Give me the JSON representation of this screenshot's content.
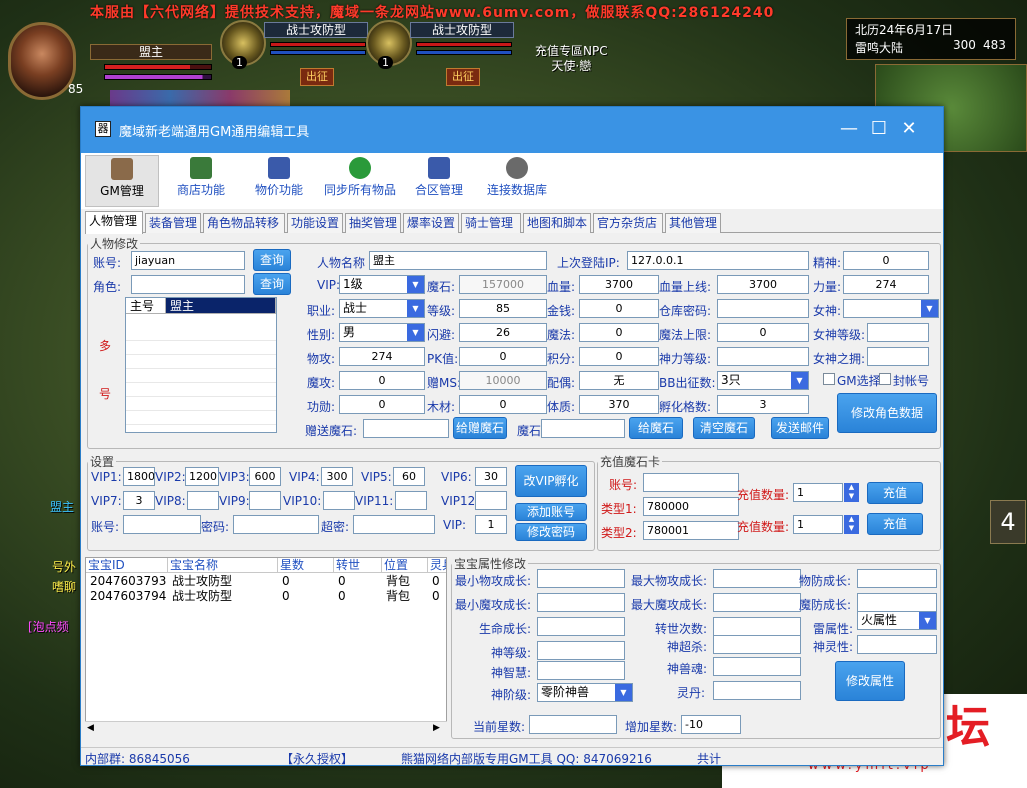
{
  "game": {
    "banner": "本服由【六代网络】提供技术支持，魔域一条龙网站www.6umv.com，做服联系QQ:286124240",
    "player_name": "盟主",
    "player_level": "85",
    "pets": [
      {
        "name": "战士攻防型",
        "level": "1",
        "button": "出征"
      },
      {
        "name": "战士攻防型",
        "level": "1",
        "button": "出征"
      }
    ],
    "npc_text": [
      "充值专區NPC",
      "天使·戀"
    ],
    "date": "北历24年6月17日",
    "map_name": "雷鸣大陆",
    "coord_x": "300",
    "coord_y": "483",
    "chat": [
      "盟主",
      "[泡点频",
      "号外",
      "嗜聊"
    ],
    "side_button": "4"
  },
  "watermark": {
    "title": "隐盟论坛",
    "url": "www.ymlt.vip"
  },
  "window": {
    "title": "魔域新老端通用GM通用编辑工具",
    "icon": "器",
    "controls": [
      "—",
      "☐",
      "✕"
    ]
  },
  "toolbar": [
    {
      "label": "GM管理",
      "icon": "person-icon",
      "color": "#8a6a4a"
    },
    {
      "label": "商店功能",
      "icon": "cart-icon",
      "color": "#3a7a3a"
    },
    {
      "label": "物价功能",
      "icon": "computer-icon",
      "color": "#3a5aaa"
    },
    {
      "label": "同步所有物品",
      "icon": "refresh-icon",
      "color": "#2a9a3a"
    },
    {
      "label": "合区管理",
      "icon": "server-icon",
      "color": "#3a5aaa"
    },
    {
      "label": "连接数据库",
      "icon": "gear-icon",
      "color": "#6a6a6a"
    }
  ],
  "tabs": [
    "人物管理",
    "装备管理",
    "角色物品转移",
    "功能设置",
    "抽奖管理",
    "爆率设置",
    "骑士管理",
    "地图和脚本",
    "官方杂货店",
    "其他管理"
  ],
  "character": {
    "legend": "人物修改",
    "account_label": "账号:",
    "account_value": "jiayuan",
    "query_label": "查询",
    "role_label": "角色:",
    "role_value": "",
    "query2_label": "查询",
    "multi_label": [
      "多",
      "号"
    ],
    "list_headers": [
      "主号",
      "盟主"
    ],
    "name_label": "人物名称",
    "name_value": "盟主",
    "last_login_label": "上次登陆IP:",
    "last_login_value": "127.0.0.1",
    "spirit_label": "精神:",
    "spirit_value": "0",
    "vip_label": "VIP:",
    "vip_value": "1级",
    "gem_label": "魔石:",
    "gem_value": "157000",
    "hp_label": "血量:",
    "hp_value": "3700",
    "hpmax_label": "血量上线:",
    "hpmax_value": "3700",
    "power_label": "力量:",
    "power_value": "274",
    "job_label": "职业:",
    "job_value": "战士",
    "level_label": "等级:",
    "level_value": "85",
    "gold_label": "金钱:",
    "gold_value": "0",
    "storepw_label": "仓库密码:",
    "storepw_value": "",
    "goddess_label": "女神:",
    "goddess_value": "",
    "sex_label": "性别:",
    "sex_value": "男",
    "dodge_label": "闪避:",
    "dodge_value": "26",
    "magic_label": "魔法:",
    "magic_value": "0",
    "magicmax_label": "魔法上限:",
    "magicmax_value": "0",
    "goddesslv_label": "女神等级:",
    "goddesslv_value": "",
    "phyatk_label": "物攻:",
    "phyatk_value": "274",
    "pk_label": "PK值:",
    "pk_value": "0",
    "score_label": "积分:",
    "score_value": "0",
    "divine_label": "神力等级:",
    "divine_value": "",
    "goddessfan_label": "女神之拥:",
    "goddessfan_value": "",
    "magatk_label": "魔攻:",
    "magatk_value": "0",
    "gift_label": "赠MS:",
    "gift_value": "10000",
    "spouse_label": "配偶:",
    "spouse_value": "无",
    "bb_label": "BB出征数:",
    "bb_value": "3只",
    "gm_check_label": "GM选择",
    "ban_check_label": "封帐号",
    "merit_label": "功勋:",
    "merit_value": "0",
    "wood_label": "木材:",
    "wood_value": "0",
    "body_label": "体质:",
    "body_value": "370",
    "hatch_label": "孵化格数:",
    "hatch_value": "3",
    "giftgem_label": "赠送魔石:",
    "giftgem_value": "",
    "givegift_btn": "给赠魔石",
    "gem2_label": "魔石:",
    "gem2_value": "",
    "givegem_btn": "给魔石",
    "cleargem_btn": "清空魔石",
    "mail_btn": "发送邮件",
    "modify_btn": "修改角色数据"
  },
  "settings": {
    "legend": "设置",
    "vips": [
      {
        "label": "VIP1:",
        "value": "1800"
      },
      {
        "label": "VIP2:",
        "value": "1200"
      },
      {
        "label": "VIP3:",
        "value": "600"
      },
      {
        "label": "VIP4:",
        "value": "300"
      },
      {
        "label": "VIP5:",
        "value": "60"
      },
      {
        "label": "VIP6:",
        "value": "30"
      },
      {
        "label": "VIP7:",
        "value": "3"
      },
      {
        "label": "VIP8:",
        "value": ""
      },
      {
        "label": "VIP9:",
        "value": ""
      },
      {
        "label": "VIP10:",
        "value": ""
      },
      {
        "label": "VIP11:",
        "value": ""
      },
      {
        "label": "VIP12",
        "value": ""
      }
    ],
    "hatch_btn": "改VIP孵化",
    "acc_label": "账号:",
    "acc_value": "",
    "pw_label": "密码:",
    "pw_value": "",
    "superpw_label": "超密:",
    "superpw_value": "",
    "vip_label": "VIP:",
    "vip_value": "1",
    "add_btn": "添加账号",
    "changepw_btn": "修改密码"
  },
  "recharge": {
    "legend": "充值魔石卡",
    "acc_label": "账号:",
    "acc_value": "",
    "type1_label": "类型1:",
    "type1_value": "780000",
    "type2_label": "类型2:",
    "type2_value": "780001",
    "qty_label": "充值数量:",
    "qty1_value": "1",
    "qty2_value": "1",
    "btn": "充值"
  },
  "pets_table": {
    "headers": [
      "宝宝ID",
      "宝宝名称",
      "星数",
      "转世",
      "位置",
      "灵兵"
    ],
    "rows": [
      [
        "2047603793",
        "战士攻防型",
        "0",
        "0",
        "背包",
        "0"
      ],
      [
        "2047603794",
        "战士攻防型",
        "0",
        "0",
        "背包",
        "0"
      ]
    ]
  },
  "pet_attr": {
    "legend": "宝宝属性修改",
    "min_phy": "最小物攻成长:",
    "max_phy": "最大物攻成长:",
    "phy_def": "物防成长:",
    "min_mag": "最小魔攻成长:",
    "max_mag": "最大魔攻成长:",
    "mag_def": "魔防成长:",
    "life": "生命成长:",
    "reborn": "转世次数:",
    "thunder": "雷属性:",
    "thunder_value": "火属性",
    "god_lv": "神等级:",
    "god_kill": "神超杀:",
    "god_spirit": "神灵性:",
    "god_wis": "神智慧:",
    "god_soul": "神兽魂:",
    "god_stage": "神阶级:",
    "god_stage_value": "零阶神兽",
    "pill": "灵丹:",
    "cur_star": "当前星数:",
    "cur_star_value": "",
    "add_star": "增加星数:",
    "add_star_value": "-10",
    "modify_btn": "修改属性"
  },
  "status": {
    "group": "内部群: 86845056",
    "license": "【永久授权】",
    "info": "熊猫网络内部版专用GM工具 QQ: 847069216",
    "total": "共计"
  }
}
